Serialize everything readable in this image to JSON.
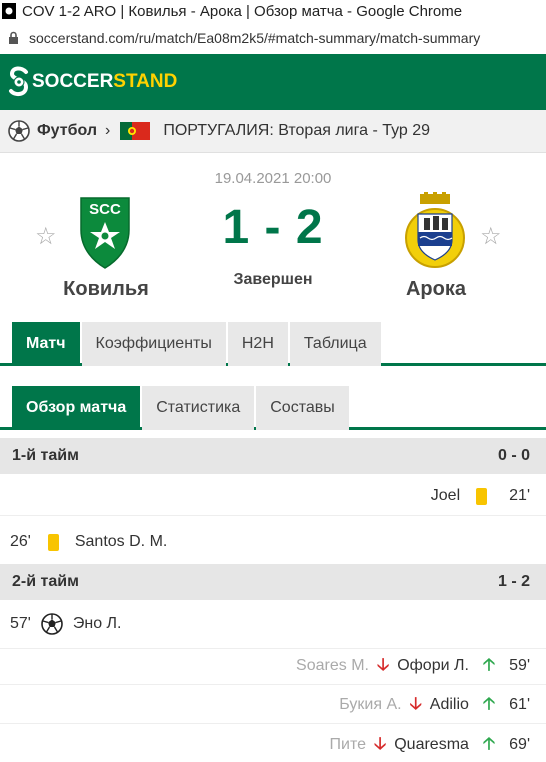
{
  "window": {
    "title": "COV 1-2 ARO | Ковилья - Арока | Обзор матча - Google Chrome"
  },
  "address": {
    "url": "soccerstand.com/ru/match/Ea08m2k5/#match-summary/match-summary"
  },
  "header": {
    "logo_part1": "SOCCER",
    "logo_part2": "STAND"
  },
  "breadcrumb": {
    "sport": "Футбол",
    "league": "ПОРТУГАЛИЯ: Вторая лига - Тур 29"
  },
  "match": {
    "date": "19.04.2021 20:00",
    "score": "1 - 2",
    "status": "Завершен",
    "home_team": "Ковилья",
    "away_team": "Арока",
    "home_crest_text": "SCC"
  },
  "tabs": {
    "main": [
      "Матч",
      "Коэффициенты",
      "H2H",
      "Таблица"
    ],
    "sub": [
      "Обзор матча",
      "Статистика",
      "Составы"
    ]
  },
  "periods": [
    {
      "label": "1-й тайм",
      "score": "0 - 0"
    },
    {
      "label": "2-й тайм",
      "score": "1 - 2"
    }
  ],
  "events": {
    "e1": {
      "player": "Joel",
      "minute": "21'"
    },
    "e2": {
      "minute": "26'",
      "player": "Santos D. M."
    },
    "e3": {
      "minute": "57'",
      "player": "Эно Л."
    },
    "e4": {
      "out": "Soares M.",
      "in": "Офори Л.",
      "minute": "59'"
    },
    "e5": {
      "out": "Букия А.",
      "in": "Adilio",
      "minute": "61'"
    },
    "e6": {
      "out": "Пите",
      "in": "Quaresma",
      "minute": "69'"
    }
  },
  "colors": {
    "brand_green": "#00764a",
    "accent_yellow": "#ffd200",
    "card_yellow": "#f8c400",
    "arrow_in": "#2fa84f",
    "arrow_out": "#d62b2b"
  }
}
